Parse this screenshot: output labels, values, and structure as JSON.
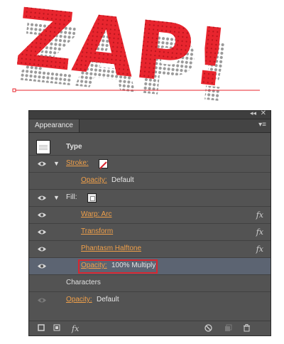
{
  "artwork": {
    "title": "ZAP!"
  },
  "panel": {
    "tab_label": "Appearance",
    "collapse_glyph": "◂◂",
    "close_glyph": "✕",
    "menu_glyph": "▾≡",
    "header_label": "Type",
    "rows": [
      {
        "label": "Stroke:",
        "value": ""
      },
      {
        "label": "Opacity:",
        "value": "Default"
      },
      {
        "label": "Fill:",
        "value": ""
      },
      {
        "label": "Warp: Arc",
        "value": ""
      },
      {
        "label": "Transform",
        "value": ""
      },
      {
        "label": "Phantasm Halftone",
        "value": ""
      },
      {
        "label": "Opacity:",
        "value": "100% Multiply"
      },
      {
        "label": "Characters",
        "value": ""
      },
      {
        "label": "Opacity:",
        "value": "Default"
      }
    ],
    "fx_label": "fx",
    "footer": {
      "fx_menu": "fx"
    }
  },
  "colors": {
    "zap_red": "#e8252e",
    "halftone_gray": "#9a9a9a",
    "link_orange": "#f0a04a",
    "highlight_red": "#d8262f",
    "selected_row": "#5c6472"
  }
}
